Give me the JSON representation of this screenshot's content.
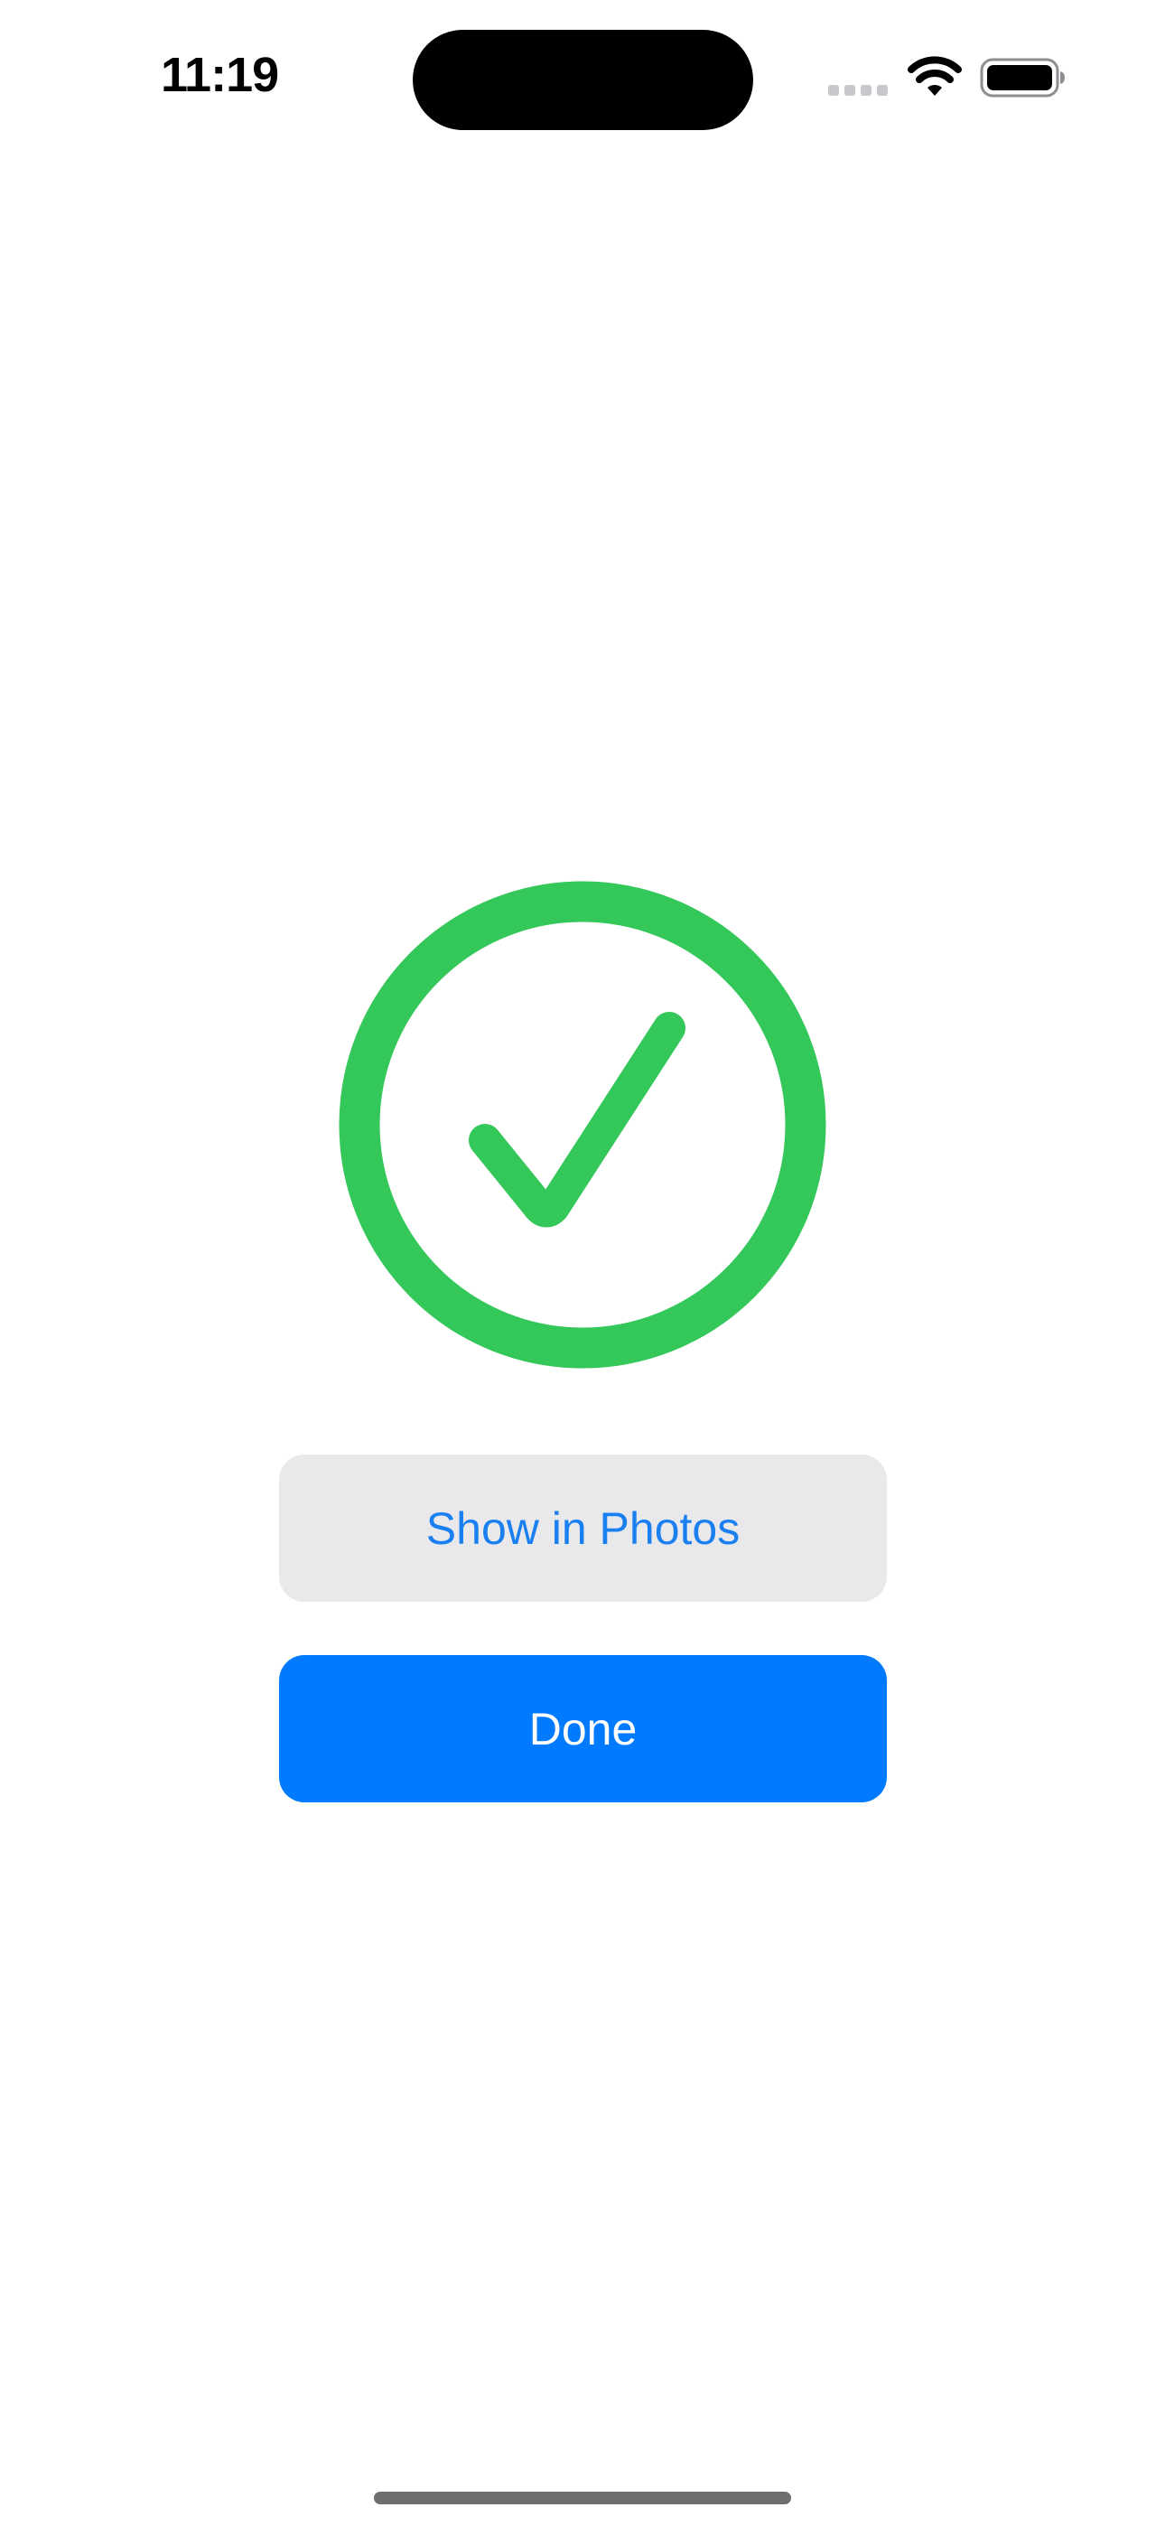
{
  "status_bar": {
    "time": "11:19",
    "icons": [
      "cellular-signal-icon",
      "wifi-icon",
      "battery-icon"
    ]
  },
  "success": {
    "icon": "checkmark-circle-icon",
    "color": "#34c759"
  },
  "buttons": {
    "show_in_photos": "Show in Photos",
    "done": "Done"
  },
  "colors": {
    "accent": "#007aff",
    "secondary_button_bg": "#e9e9eb"
  }
}
